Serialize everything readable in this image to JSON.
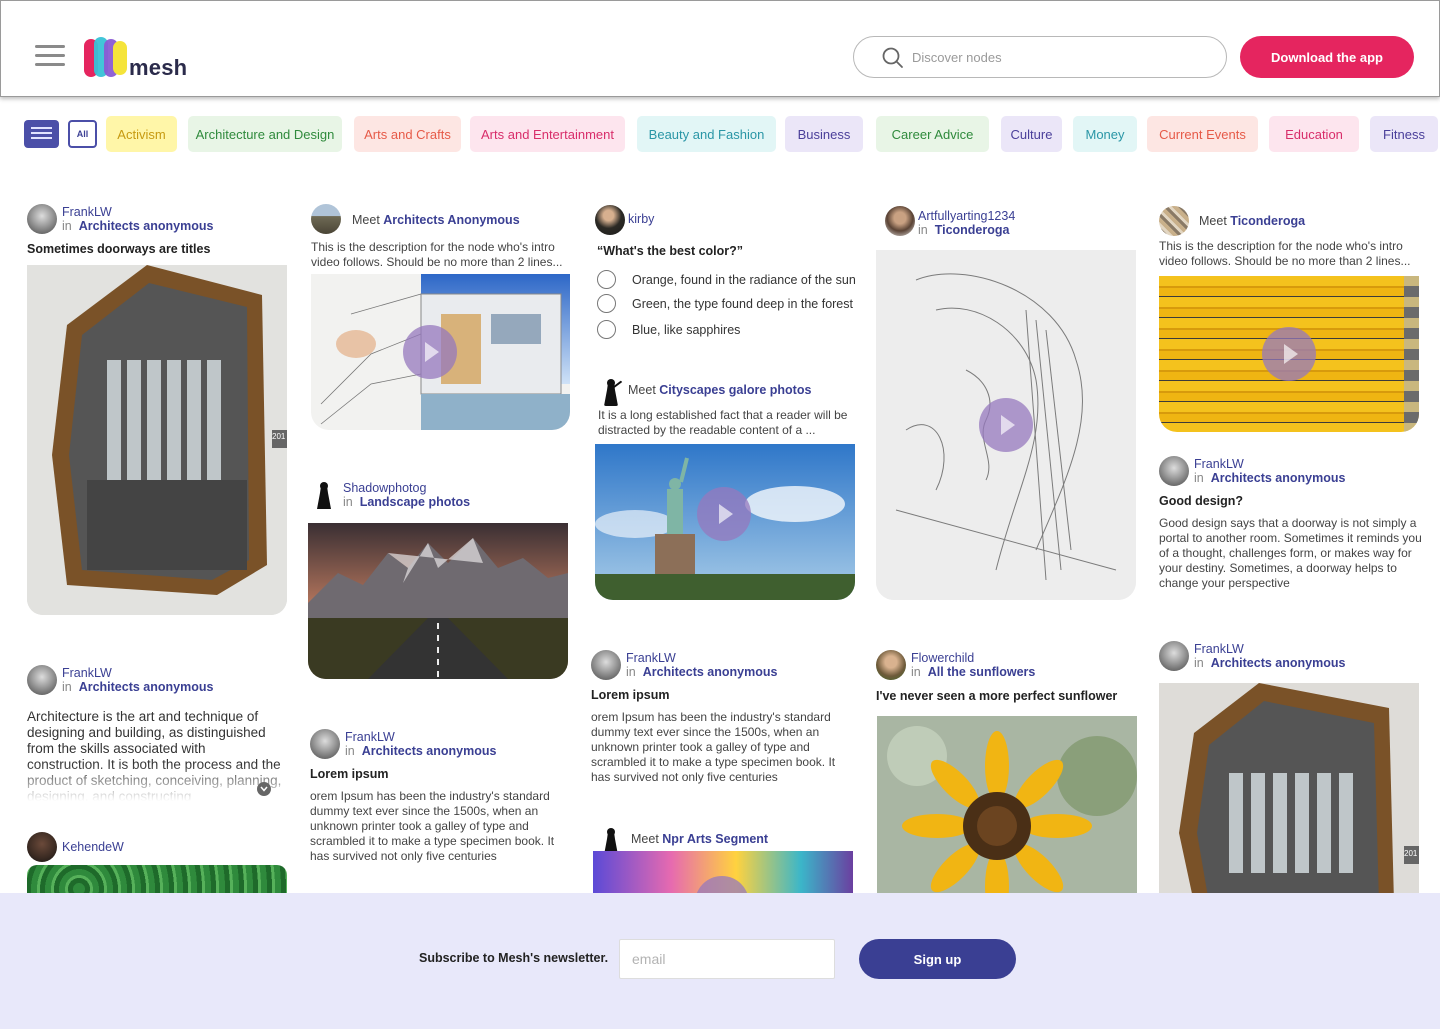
{
  "header": {
    "logo_text": "mesh",
    "search_placeholder": "Discover nodes",
    "download_label": "Download the app"
  },
  "categories": {
    "all_label": "All",
    "items": [
      {
        "label": "Activism",
        "bg": "#fff6a8",
        "fg": "#c79a11"
      },
      {
        "label": "Architecture and Design",
        "bg": "#e8f5e6",
        "fg": "#2f8a3c"
      },
      {
        "label": "Arts and Crafts",
        "bg": "#fde6e3",
        "fg": "#e65a48"
      },
      {
        "label": "Arts and Entertainment",
        "bg": "#fde5ee",
        "fg": "#d82d6a"
      },
      {
        "label": "Beauty and Fashion",
        "bg": "#e2f6f6",
        "fg": "#2a96a6"
      },
      {
        "label": "Business",
        "bg": "#ebe6f8",
        "fg": "#4a3f9a"
      },
      {
        "label": "Career Advice",
        "bg": "#e8f5e6",
        "fg": "#2f8a3c"
      },
      {
        "label": "Culture",
        "bg": "#ebe6f8",
        "fg": "#4a3f9a"
      },
      {
        "label": "Money",
        "bg": "#e2f6f6",
        "fg": "#2a96a6"
      },
      {
        "label": "Current Events",
        "bg": "#fde6e3",
        "fg": "#e65a48"
      },
      {
        "label": "Education",
        "bg": "#fde5ee",
        "fg": "#d82d6a"
      },
      {
        "label": "Fitness",
        "bg": "#ebe6f8",
        "fg": "#4a3f9a"
      }
    ]
  },
  "col1": {
    "c1": {
      "user": "FrankLW",
      "in": "in",
      "group": "Architects anonymous",
      "title": "Sometimes doorways are titles",
      "badge": "201"
    },
    "c2": {
      "user": "FrankLW",
      "in": "in",
      "group": "Architects anonymous",
      "text": "Architecture is the art and technique of designing and building, as distinguished from the skills associated with construction. It is both the process and the product of sketching, conceiving, planning, designing, and constructing"
    },
    "c3": {
      "user": "KehendeW"
    }
  },
  "col2": {
    "c1": {
      "meet": "Meet",
      "node": "Architects Anonymous",
      "desc": "This is the description for the node who's intro video follows. Should be no more than 2 lines..."
    },
    "c2": {
      "user": "Shadowphotog",
      "in": "in",
      "group": "Landscape photos"
    },
    "c3": {
      "user": "FrankLW",
      "in": "in",
      "group": "Architects anonymous",
      "title": "Lorem ipsum",
      "desc": "orem Ipsum has been the industry's standard dummy text ever since the 1500s, when an unknown printer took a galley of type and scrambled it to make a type specimen book. It has survived not only five centuries"
    }
  },
  "col3": {
    "c1": {
      "user": "kirby",
      "question": "“What's the best color?”",
      "options": [
        "Orange, found in the radiance of the sun",
        "Green, the type found deep in the forest",
        "Blue, like sapphires"
      ]
    },
    "c2": {
      "meet": "Meet",
      "node": "Cityscapes galore photos",
      "desc": "It is a long established fact that a reader will be distracted by the readable content of a ..."
    },
    "c3": {
      "user": "FrankLW",
      "in": "in",
      "group": "Architects anonymous",
      "title": "Lorem ipsum",
      "desc": "orem Ipsum has been the industry's standard dummy text ever since the 1500s, when an unknown printer took a galley of type and scrambled it to make a type specimen book. It has survived not only five centuries"
    },
    "c4": {
      "meet": "Meet",
      "node": "Npr Arts Segment"
    }
  },
  "col4": {
    "c1": {
      "user": "Artfullyarting1234",
      "in": "in",
      "group": "Ticonderoga"
    },
    "c2": {
      "user": "Flowerchild",
      "in": "in",
      "group": "All the sunflowers",
      "title": "I've never seen a more perfect sunflower"
    }
  },
  "col5": {
    "c1": {
      "meet": "Meet",
      "node": "Ticonderoga",
      "desc": "This is the description for the node who's intro video follows. Should be no more than 2 lines..."
    },
    "c2": {
      "user": "FrankLW",
      "in": "in",
      "group": "Architects anonymous",
      "title": "Good design?",
      "desc": "Good design says that a doorway is not simply a portal to another room. Sometimes it reminds you of a thought, challenges form, or makes way for your destiny. Sometimes, a doorway helps to change your perspective"
    },
    "c3": {
      "user": "FrankLW",
      "in": "in",
      "group": "Architects anonymous",
      "badge": "201"
    }
  },
  "newsletter": {
    "label": "Subscribe to Mesh's newsletter.",
    "email_placeholder": "email",
    "signup_label": "Sign up"
  }
}
